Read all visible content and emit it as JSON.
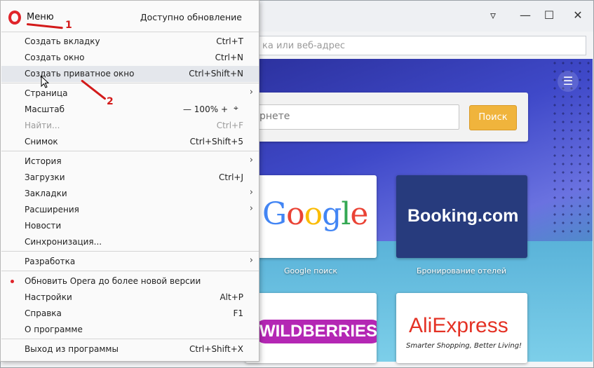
{
  "window": {
    "address_placeholder": "ка или веб-адрес",
    "controls": [
      "easy-setup-icon",
      "minimize-icon",
      "maximize-icon",
      "close-icon"
    ]
  },
  "speeddial": {
    "search_placeholder": "рнете",
    "search_button": "Поиск",
    "tiles": [
      {
        "logo": "Google",
        "caption": "Google поиск"
      },
      {
        "logo": "Booking.com",
        "caption": "Бронирование отелей"
      },
      {
        "logo": "WILDBERRIES",
        "caption": ""
      },
      {
        "logo": "AliExpress",
        "tagline": "Smarter Shopping, Better Living!",
        "caption": ""
      }
    ]
  },
  "menu": {
    "title": "Меню",
    "update": "Доступно обновление",
    "items": {
      "new_tab": {
        "label": "Создать вкладку",
        "shortcut": "Ctrl+T"
      },
      "new_window": {
        "label": "Создать окно",
        "shortcut": "Ctrl+N"
      },
      "private_window": {
        "label": "Создать приватное окно",
        "shortcut": "Ctrl+Shift+N"
      },
      "page": {
        "label": "Страница"
      },
      "zoom": {
        "label": "Масштаб",
        "minus": "—",
        "value": "100%",
        "plus": "+"
      },
      "find": {
        "label": "Найти...",
        "shortcut": "Ctrl+F"
      },
      "snapshot": {
        "label": "Снимок",
        "shortcut": "Ctrl+Shift+5"
      },
      "history": {
        "label": "История"
      },
      "downloads": {
        "label": "Загрузки",
        "shortcut": "Ctrl+J"
      },
      "bookmarks": {
        "label": "Закладки"
      },
      "extensions": {
        "label": "Расширения"
      },
      "news": {
        "label": "Новости"
      },
      "sync": {
        "label": "Синхронизация..."
      },
      "developer": {
        "label": "Разработка"
      },
      "update_opera": {
        "label": "Обновить Opera до более новой версии"
      },
      "settings": {
        "label": "Настройки",
        "shortcut": "Alt+P"
      },
      "help": {
        "label": "Справка",
        "shortcut": "F1"
      },
      "about": {
        "label": "О программе"
      },
      "exit": {
        "label": "Выход из программы",
        "shortcut": "Ctrl+Shift+X"
      }
    }
  },
  "annotations": {
    "one": "1",
    "two": "2"
  },
  "colors": {
    "opera_red": "#e0242a",
    "annotation_red": "#d31a1a",
    "search_button": "#f0b43c"
  }
}
